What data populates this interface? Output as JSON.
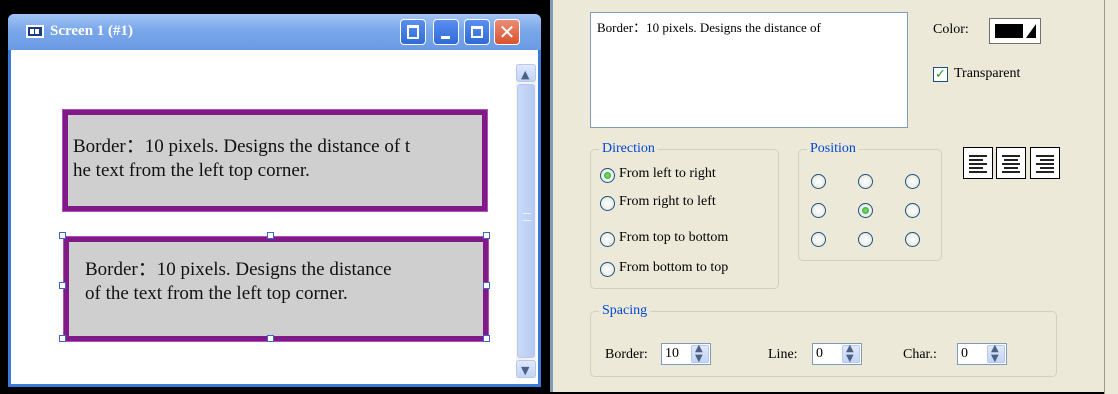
{
  "window": {
    "title": "Screen 1 (#1)",
    "icons": {
      "app": "screen-icon",
      "restore": "restore-icon",
      "minimize": "minimize-icon",
      "maximize": "maximize-icon",
      "close": "close-icon"
    }
  },
  "canvas": {
    "text_boxes": [
      {
        "lines": [
          "Border：10 pixels. Designs the distance of t",
          "he text from the left top corner."
        ]
      },
      {
        "lines": [
          "Border：10 pixels. Designs the distance",
          "of the text from the left top corner."
        ]
      }
    ]
  },
  "properties": {
    "preview_text": "Border：10 pixels. Designs the distance of",
    "color_label": "Color:",
    "color_value": "#000000",
    "transparent_label": "Transparent",
    "transparent_checked": true,
    "direction": {
      "legend": "Direction",
      "options": [
        "From left to right",
        "From right to left",
        "From top to bottom",
        "From bottom to top"
      ],
      "selected": "From left to right"
    },
    "position": {
      "legend": "Position",
      "selected": "middle-center"
    },
    "alignment": [
      "align-left-icon",
      "align-center-icon",
      "align-right-icon"
    ],
    "spacing": {
      "legend": "Spacing",
      "border_label": "Border:",
      "border_value": "10",
      "line_label": "Line:",
      "line_value": "0",
      "char_label": "Char.:",
      "char_value": "0"
    }
  },
  "colors": {
    "title_bar": "#7aa7ea",
    "textbox_border": "#801a86",
    "textbox_fill": "#cfcfcf",
    "panel_bg": "#ece9d8",
    "group_legend": "#0046d5"
  }
}
